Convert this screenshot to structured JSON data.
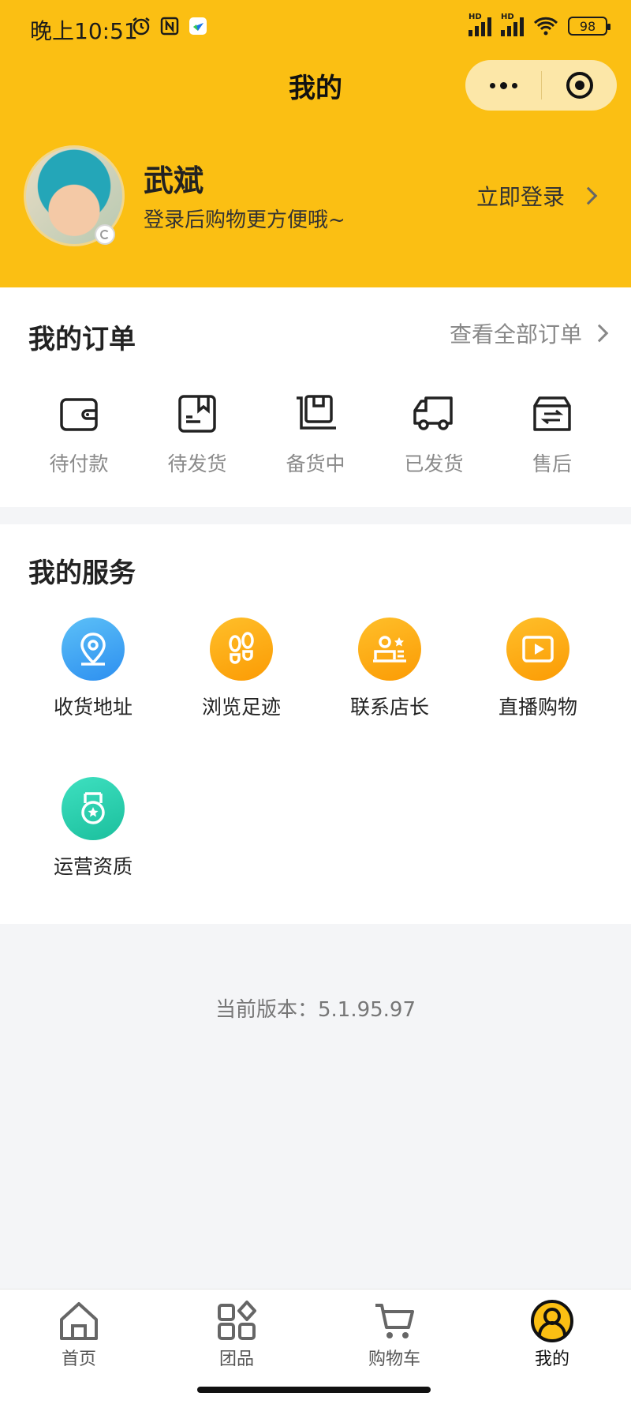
{
  "status_bar": {
    "time": "晚上10:51",
    "battery": "98",
    "hd1": "HD",
    "hd2": "HD"
  },
  "header": {
    "title": "我的",
    "user_name": "武斌",
    "user_subtitle": "登录后购物更方便哦~",
    "login_label": "立即登录"
  },
  "orders": {
    "title": "我的订单",
    "view_all": "查看全部订单",
    "items": [
      {
        "label": "待付款",
        "icon": "wallet-icon"
      },
      {
        "label": "待发货",
        "icon": "package-icon"
      },
      {
        "label": "备货中",
        "icon": "box-icon"
      },
      {
        "label": "已发货",
        "icon": "truck-icon"
      },
      {
        "label": "售后",
        "icon": "return-box-icon"
      }
    ]
  },
  "services": {
    "title": "我的服务",
    "items": [
      {
        "label": "收货地址",
        "icon": "location-icon",
        "color": "#3aa3f3"
      },
      {
        "label": "浏览足迹",
        "icon": "footprint-icon",
        "color": "#fdaa16"
      },
      {
        "label": "联系店长",
        "icon": "contact-icon",
        "color": "#fdaa16"
      },
      {
        "label": "直播购物",
        "icon": "play-icon",
        "color": "#fdaa16"
      },
      {
        "label": "运营资质",
        "icon": "medal-icon",
        "color": "#2ad0ae"
      }
    ]
  },
  "version_text": "当前版本：5.1.95.97",
  "tabbar": {
    "items": [
      {
        "label": "首页",
        "icon": "home-icon"
      },
      {
        "label": "团品",
        "icon": "grid-icon"
      },
      {
        "label": "购物车",
        "icon": "cart-icon"
      },
      {
        "label": "我的",
        "icon": "profile-icon",
        "active": true
      }
    ]
  },
  "colors": {
    "brand": "#fbbf13",
    "background": "#f4f5f7"
  }
}
